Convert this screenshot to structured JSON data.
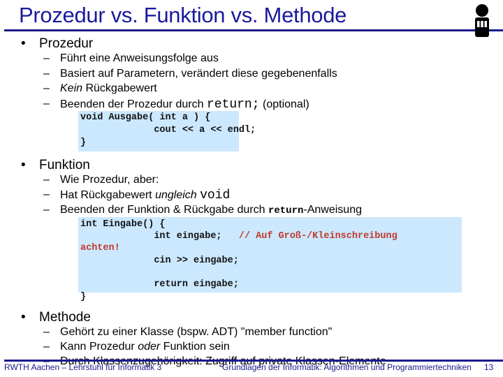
{
  "slide": {
    "title": "Prozedur vs. Funktion vs. Methode",
    "logo_icon": "university-logo-icon",
    "sections": [
      {
        "heading": "Prozedur",
        "items": [
          {
            "text": "Führt eine Anweisungsfolge aus"
          },
          {
            "text": "Basiert auf Parametern, verändert diese gegebenenfalls"
          },
          {
            "italic": "Kein",
            "text": " Rückgabewert"
          },
          {
            "text": "Beenden der Prozedur durch ",
            "code": "return;",
            "suffix": " (optional)"
          }
        ],
        "code_lines": [
          "void Ausgabe( int a ) {",
          "             cout << a << endl;",
          "}"
        ]
      },
      {
        "heading": "Funktion",
        "items": [
          {
            "text": "Wie Prozedur, aber:"
          },
          {
            "text": "Hat Rückgabewert ",
            "italic": "ungleich",
            "code": "void"
          },
          {
            "text": "Beenden der Funktion & Rückgabe durch ",
            "code": "return",
            "suffix": "-Anweisung"
          }
        ],
        "code_lines": [
          "int Eingabe() {",
          "             int eingabe;   ",
          "             cin >> eingabe;",
          "",
          "             return eingabe;",
          "}"
        ],
        "code_comment": "// Auf Groß-/Kleinschreibung",
        "code_comment_wrap": "achten!"
      },
      {
        "heading": "Methode",
        "items": [
          {
            "text": "Gehört zu einer Klasse (bspw. ADT) \"member function\""
          },
          {
            "text": "Kann Prozedur ",
            "italic": "oder",
            "suffix": " Funktion sein"
          },
          {
            "text": "Durch Klassenzugehörigkeit: Zugriff auf private Klassen-Elemente"
          }
        ]
      }
    ],
    "bullet": "•",
    "dash": "–"
  },
  "footer": {
    "left": "RWTH Aachen – Lehrstuhl für Informatik 3",
    "center": "Grundlagen der Informatik: Algorithmen und Programmiertechniken",
    "page": "13"
  },
  "colors": {
    "title": "#1a1a9c",
    "rule": "#1a1a8c",
    "code_bg": "#cce8ff",
    "comment": "#c0392b"
  }
}
